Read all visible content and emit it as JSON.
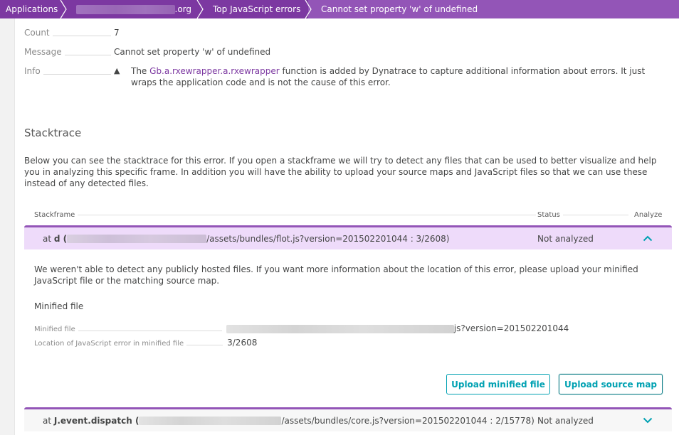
{
  "breadcrumb": {
    "items": [
      {
        "label": "Applications"
      },
      {
        "label_suffix": ".org",
        "redacted": true
      },
      {
        "label": "Top JavaScript errors"
      },
      {
        "label": "Cannot set property 'w' of undefined"
      }
    ]
  },
  "properties": {
    "count": {
      "label": "Count",
      "value": "7"
    },
    "message": {
      "label": "Message",
      "value": "Cannot set property 'w' of undefined"
    },
    "info": {
      "label": "Info",
      "icon": "warning-icon",
      "prefix": "The ",
      "link": "Gb.a.rxewrapper.a.rxewrapper",
      "suffix": " function is added by Dynatrace to capture additional information about errors. It just wraps the application code and is not the cause of this error."
    }
  },
  "stacktrace": {
    "title": "Stacktrace",
    "description": "Below you can see the stacktrace for this error. If you open a stackframe we will try to detect any files that can be used to better visualize and help you in analyzing this specific frame. In addition you will have the ability to upload your source maps and JavaScript files so that we can use these instead of any detected files.",
    "columns": {
      "stackframe": "Stackframe",
      "status": "Status",
      "analyze": "Analyze"
    },
    "frames": [
      {
        "prefix": "at ",
        "function": "d",
        "open_paren": " (",
        "path": "/assets/bundles/flot.js?version=201502201044 : 3/2608)",
        "status": "Not analyzed",
        "expanded": true
      },
      {
        "prefix": "at ",
        "function": "J.event.dispatch",
        "open_paren": " (",
        "path": "/assets/bundles/core.js?version=201502201044 : 2/15778)",
        "status": "Not analyzed",
        "expanded": false
      }
    ],
    "detail": {
      "description": "We weren't able to detect any publicly hosted files. If you want more information about the location of this error, please upload your minified JavaScript file or the matching source map.",
      "subtitle": "Minified file",
      "minified_file": {
        "label": "Minified file",
        "value_suffix": "js?version=201502201044"
      },
      "location": {
        "label": "Location of JavaScript error in minified file",
        "value": "3/2608"
      },
      "buttons": {
        "upload_minified": "Upload minified file",
        "upload_sourcemap": "Upload source map"
      }
    }
  },
  "colors": {
    "breadcrumb_bg": "#7c38a1",
    "breadcrumb_active_bg": "#9355b7",
    "link": "#7c38a1",
    "accent_teal": "#00a1b2",
    "expanded_row_bg": "#eedbfa"
  }
}
